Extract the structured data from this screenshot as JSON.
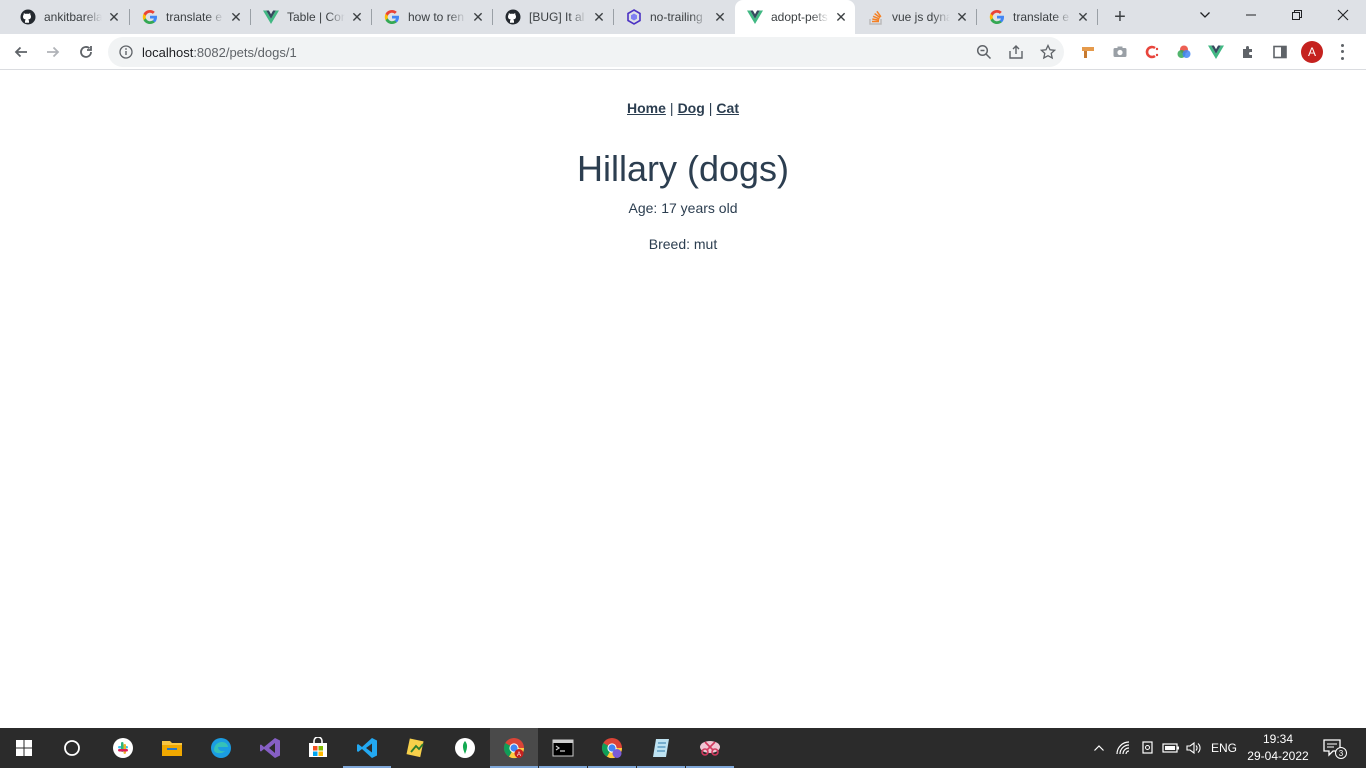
{
  "browser": {
    "tabs": [
      {
        "title": "ankitbarela",
        "icon": "github-icon"
      },
      {
        "title": "translate e",
        "icon": "google-icon"
      },
      {
        "title": "Table | Con",
        "icon": "vue-icon"
      },
      {
        "title": "how to ren",
        "icon": "google-icon"
      },
      {
        "title": "[BUG] It al",
        "icon": "github-icon"
      },
      {
        "title": "no-trailing",
        "icon": "eslint-icon"
      },
      {
        "title": "adopt-pets",
        "icon": "vue-icon"
      },
      {
        "title": "vue js dyna",
        "icon": "stackoverflow-icon"
      },
      {
        "title": "translate e",
        "icon": "google-icon"
      }
    ],
    "active_tab": 6,
    "url_host": "localhost",
    "url_path": ":8082/pets/dogs/1",
    "profile_initial": "A"
  },
  "nav": {
    "home": "Home",
    "dog": "Dog",
    "cat": "Cat",
    "separator": "|"
  },
  "pet": {
    "title": "Hillary (dogs)",
    "age": "Age: 17 years old",
    "breed": "Breed: mut"
  },
  "taskbar": {
    "language": "ENG",
    "time": "19:34",
    "date": "29-04-2022",
    "notifications": "3",
    "chrome_badge": "A"
  },
  "colors": {
    "text": "#2c3e50",
    "tabstrip": "#dee1e6",
    "taskbar": "#2b2b2b",
    "avatar": "#c5221f"
  }
}
